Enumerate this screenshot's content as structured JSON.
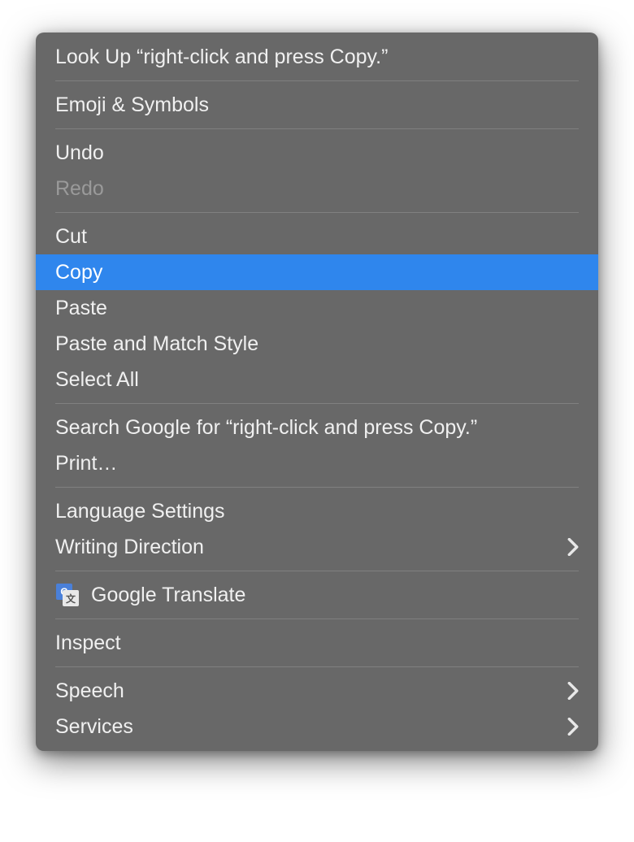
{
  "menu": {
    "groups": [
      [
        {
          "id": "look-up",
          "label": "Look Up “right-click and press Copy.”",
          "highlighted": false,
          "disabled": false,
          "submenu": false,
          "icon": null
        }
      ],
      [
        {
          "id": "emoji-symbols",
          "label": "Emoji & Symbols",
          "highlighted": false,
          "disabled": false,
          "submenu": false,
          "icon": null
        }
      ],
      [
        {
          "id": "undo",
          "label": "Undo",
          "highlighted": false,
          "disabled": false,
          "submenu": false,
          "icon": null
        },
        {
          "id": "redo",
          "label": "Redo",
          "highlighted": false,
          "disabled": true,
          "submenu": false,
          "icon": null
        }
      ],
      [
        {
          "id": "cut",
          "label": "Cut",
          "highlighted": false,
          "disabled": false,
          "submenu": false,
          "icon": null
        },
        {
          "id": "copy",
          "label": "Copy",
          "highlighted": true,
          "disabled": false,
          "submenu": false,
          "icon": null
        },
        {
          "id": "paste",
          "label": "Paste",
          "highlighted": false,
          "disabled": false,
          "submenu": false,
          "icon": null
        },
        {
          "id": "paste-match-style",
          "label": "Paste and Match Style",
          "highlighted": false,
          "disabled": false,
          "submenu": false,
          "icon": null
        },
        {
          "id": "select-all",
          "label": "Select All",
          "highlighted": false,
          "disabled": false,
          "submenu": false,
          "icon": null
        }
      ],
      [
        {
          "id": "search-google",
          "label": "Search Google for “right-click and press Copy.”",
          "highlighted": false,
          "disabled": false,
          "submenu": false,
          "icon": null
        },
        {
          "id": "print",
          "label": "Print…",
          "highlighted": false,
          "disabled": false,
          "submenu": false,
          "icon": null
        }
      ],
      [
        {
          "id": "language-settings",
          "label": "Language Settings",
          "highlighted": false,
          "disabled": false,
          "submenu": false,
          "icon": null
        },
        {
          "id": "writing-direction",
          "label": "Writing Direction",
          "highlighted": false,
          "disabled": false,
          "submenu": true,
          "icon": null
        }
      ],
      [
        {
          "id": "google-translate",
          "label": "Google Translate",
          "highlighted": false,
          "disabled": false,
          "submenu": false,
          "icon": "google-translate"
        }
      ],
      [
        {
          "id": "inspect",
          "label": "Inspect",
          "highlighted": false,
          "disabled": false,
          "submenu": false,
          "icon": null
        }
      ],
      [
        {
          "id": "speech",
          "label": "Speech",
          "highlighted": false,
          "disabled": false,
          "submenu": true,
          "icon": null
        },
        {
          "id": "services",
          "label": "Services",
          "highlighted": false,
          "disabled": false,
          "submenu": true,
          "icon": null
        }
      ]
    ],
    "colors": {
      "menu_bg": "#686868",
      "highlight_bg": "#2f86ed",
      "text": "#f0f0f0",
      "disabled_text": "#9a9a9a",
      "separator": "#808080"
    }
  }
}
